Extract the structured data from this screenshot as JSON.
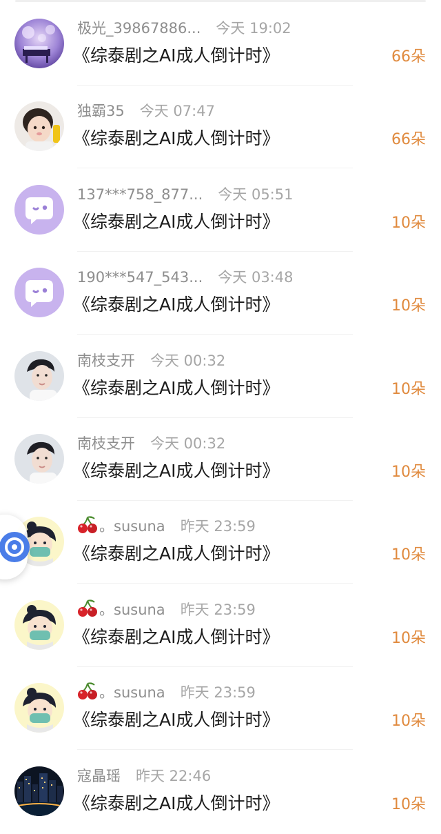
{
  "gift_list": [
    {
      "user": "极光_39867886...",
      "time": "今天 19:02",
      "book": "《综泰剧之AI成人倒计时》",
      "amount": "66朵",
      "avatar": "purple-piano"
    },
    {
      "user": "独霸35",
      "time": "今天 07:47",
      "book": "《综泰剧之AI成人倒计时》",
      "amount": "66朵",
      "avatar": "baby-photo"
    },
    {
      "user": "137***758_877...",
      "time": "今天 05:51",
      "book": "《综泰剧之AI成人倒计时》",
      "amount": "10朵",
      "avatar": "default-chat"
    },
    {
      "user": "190***547_543...",
      "time": "今天 03:48",
      "book": "《综泰剧之AI成人倒计时》",
      "amount": "10朵",
      "avatar": "default-chat"
    },
    {
      "user": "南枝支开",
      "time": "今天 00:32",
      "book": "《综泰剧之AI成人倒计时》",
      "amount": "10朵",
      "avatar": "man-photo"
    },
    {
      "user": "南枝支开",
      "time": "今天 00:32",
      "book": "《综泰剧之AI成人倒计时》",
      "amount": "10朵",
      "avatar": "man-photo"
    },
    {
      "user": "。susuna",
      "time": "昨天 23:59",
      "book": "《综泰剧之AI成人倒计时》",
      "amount": "10朵",
      "avatar": "cartoon-boy",
      "user_prefix_icon": "cherry-icon"
    },
    {
      "user": "。susuna",
      "time": "昨天 23:59",
      "book": "《综泰剧之AI成人倒计时》",
      "amount": "10朵",
      "avatar": "cartoon-boy",
      "user_prefix_icon": "cherry-icon"
    },
    {
      "user": "。susuna",
      "time": "昨天 23:59",
      "book": "《综泰剧之AI成人倒计时》",
      "amount": "10朵",
      "avatar": "cartoon-boy",
      "user_prefix_icon": "cherry-icon"
    },
    {
      "user": "寇晶瑶",
      "time": "昨天 22:46",
      "book": "《综泰剧之AI成人倒计时》",
      "amount": "10朵",
      "avatar": "city-night"
    }
  ],
  "colors": {
    "amount": "#e08a3e",
    "user": "#8e8e8e",
    "book": "#1c1c1c",
    "float_button": "#4a7de8"
  }
}
